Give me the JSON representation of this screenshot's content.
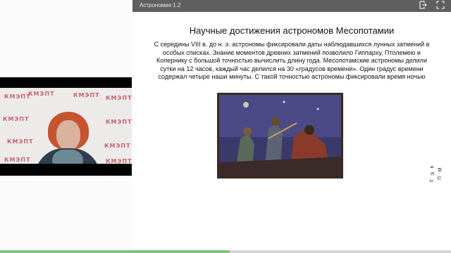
{
  "header": {
    "title": "Астрономия 1.2",
    "exit_icon": "exit-icon",
    "fullscreen_icon": "fullscreen-icon"
  },
  "slide": {
    "heading": "Научные достижения астрономов Месопотамии",
    "body": "С середины VIII в. до н. э. астрономы фиксировали даты наблюдавшихся лунных затмений в особых списках. Знание моментов древних затмений позволило Гиппарху, Птолемею и Копернику с большой точностью вычислить длину года. Месопотамские астрономы делили сутки на 12 часов, каждый час делился на 30 «градусов времени». Один градус времени содержал четыре наши минуты. С такой точностью астрономы фиксировали время ночью",
    "vertical_logo": [
      "К",
      "Э",
      "Т",
      "М",
      "П"
    ]
  },
  "video": {
    "backdrop_logo": "КМЭПТ"
  },
  "progress": {
    "fraction": 0.51
  },
  "colors": {
    "header_bg": "#5f5f5f",
    "progress": "#7cc67a",
    "logo": "#c6485a"
  }
}
